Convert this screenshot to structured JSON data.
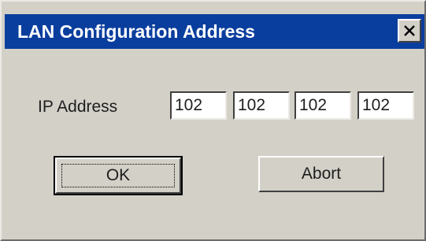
{
  "dialog": {
    "title": "LAN Configuration Address",
    "close_icon": "close-icon"
  },
  "form": {
    "ip_label": "IP Address",
    "ip_octets": [
      "102",
      "102",
      "102",
      "102"
    ]
  },
  "buttons": {
    "ok_label": "OK",
    "abort_label": "Abort"
  },
  "colors": {
    "titlebar": "#0a3e9e",
    "face": "#d3d0c8"
  }
}
